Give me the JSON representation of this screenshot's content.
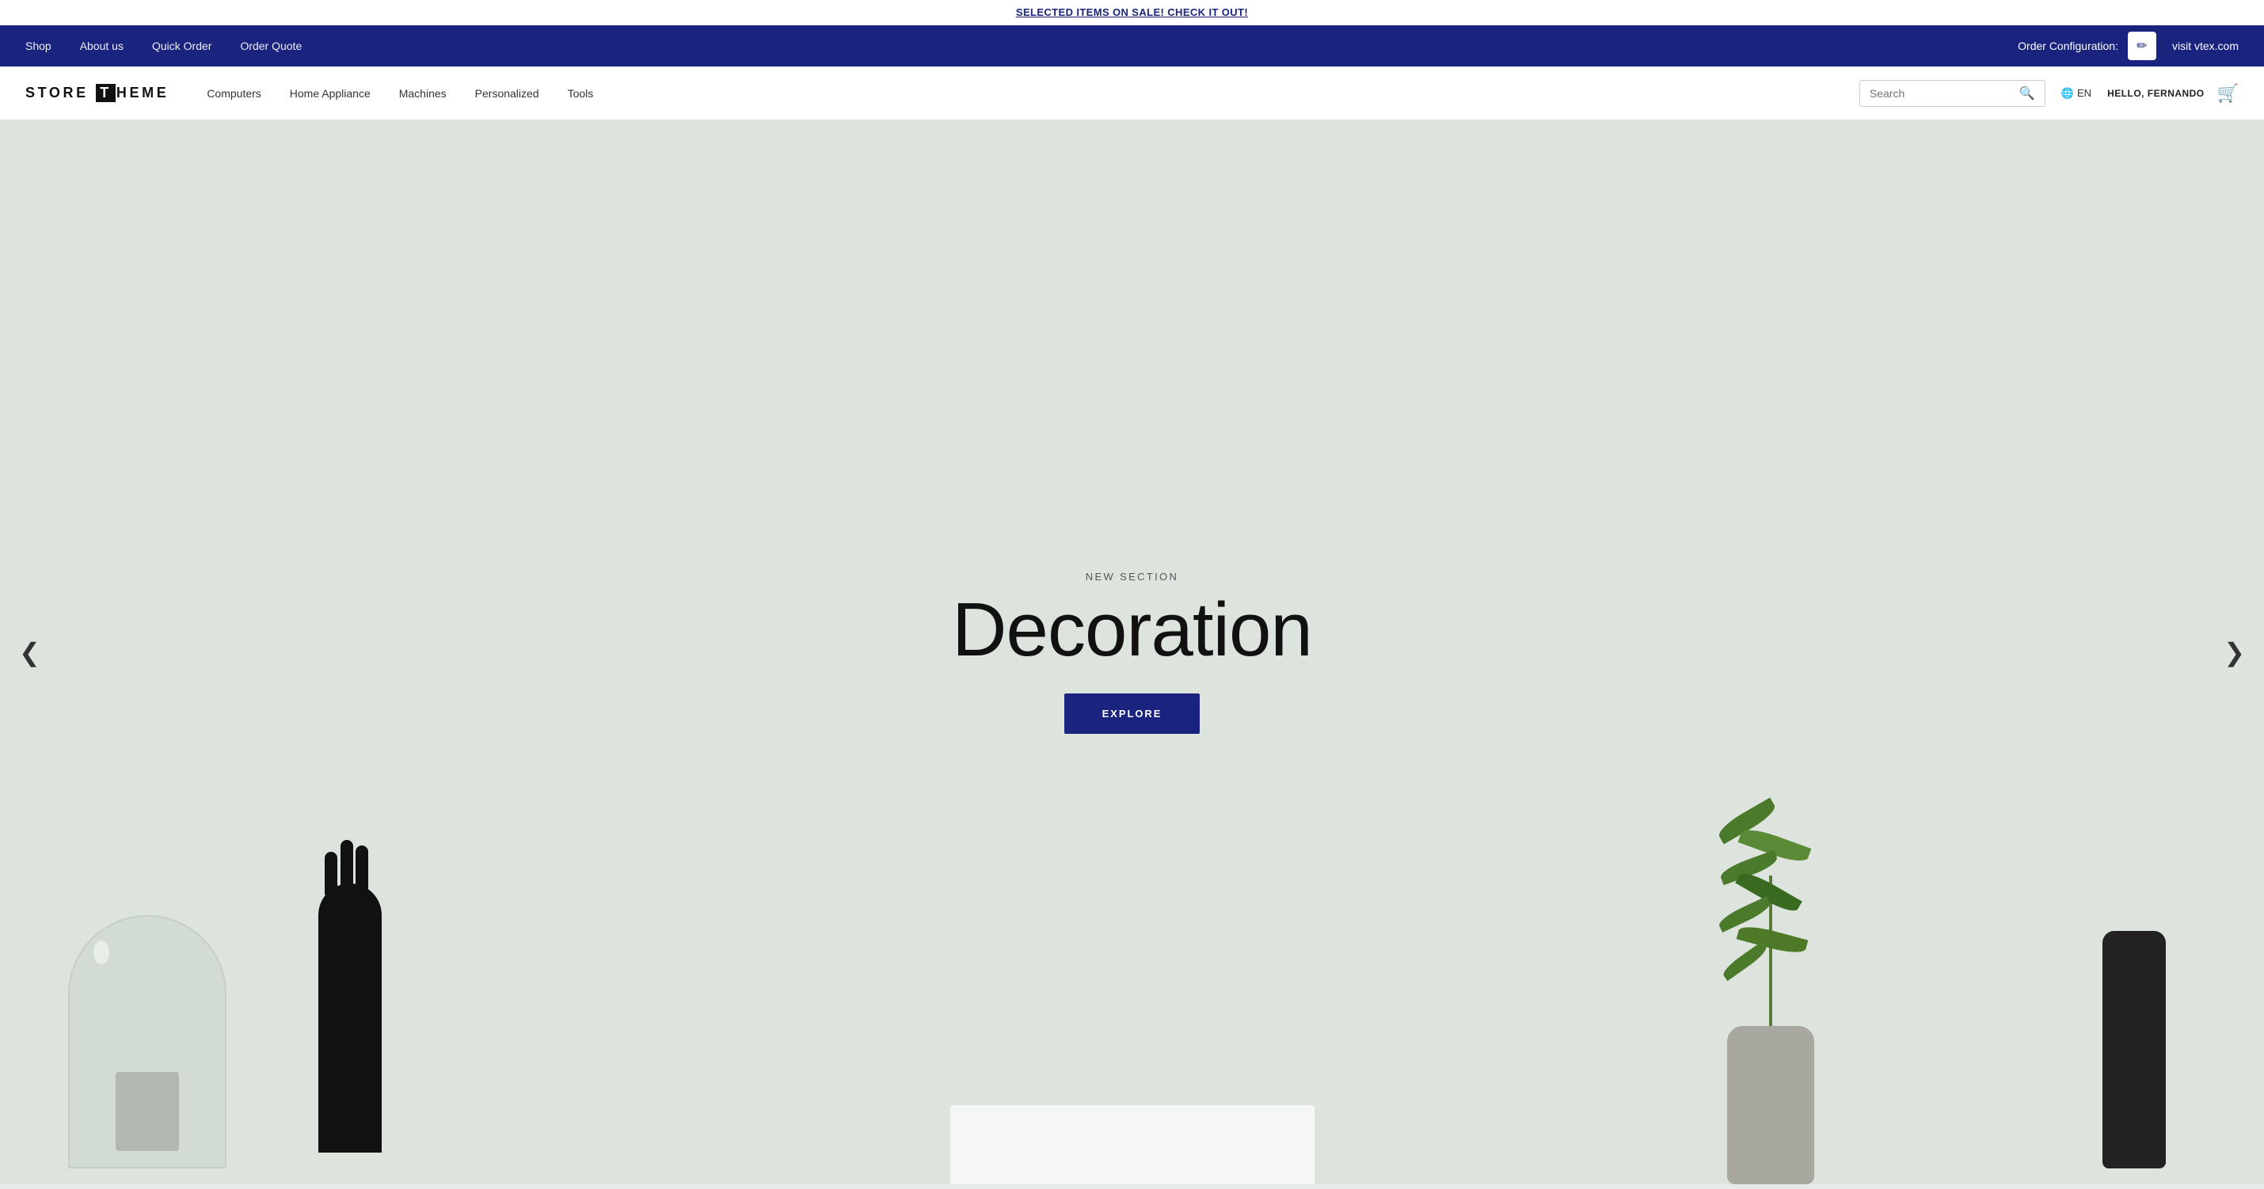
{
  "announcement": {
    "text": "SELECTED ITEMS ON SALE! CHECK IT OUT!",
    "link": "SELECTED ITEMS ON SALE! CHECK IT OUT!"
  },
  "top_nav": {
    "links": [
      {
        "label": "Shop",
        "href": "#"
      },
      {
        "label": "About us",
        "href": "#"
      },
      {
        "label": "Quick Order",
        "href": "#"
      },
      {
        "label": "Order Quote",
        "href": "#"
      }
    ],
    "order_config_label": "Order Configuration:",
    "pencil_icon": "✏",
    "visit_link": "visit vtex.com"
  },
  "main_nav": {
    "logo": "STORE THEME",
    "links": [
      {
        "label": "Computers",
        "href": "#"
      },
      {
        "label": "Home Appliance",
        "href": "#"
      },
      {
        "label": "Machines",
        "href": "#"
      },
      {
        "label": "Personalized",
        "href": "#"
      },
      {
        "label": "Tools",
        "href": "#"
      }
    ],
    "search_placeholder": "Search",
    "search_icon": "🔍",
    "language": "EN",
    "globe_icon": "🌐",
    "user_greeting": "HELLO, FERNANDO",
    "cart_icon": "🛒"
  },
  "hero": {
    "subtitle": "NEW SECTION",
    "title": "Decoration",
    "cta_label": "EXPLORE",
    "carousel_prev": "❮",
    "carousel_next": "❯"
  }
}
